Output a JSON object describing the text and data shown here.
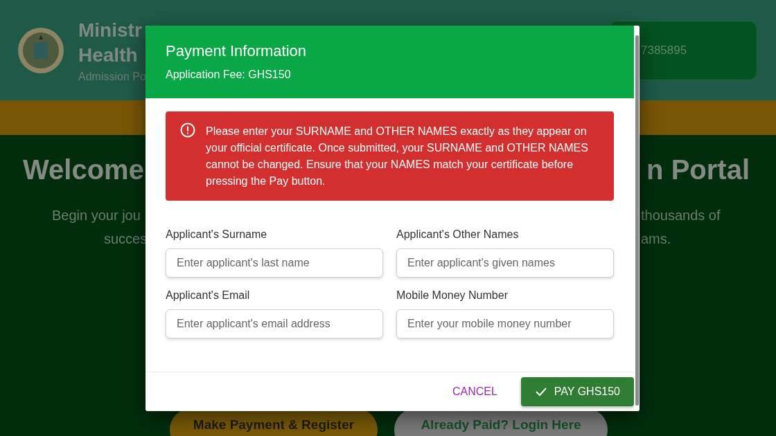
{
  "background": {
    "header": {
      "title_lines": [
        "Ministr",
        "Health"
      ],
      "subtitle": "Admission Po",
      "contact": "7385895"
    },
    "hero": {
      "heading_left": "Welcome",
      "heading_right": "n Portal",
      "text_left": [
        "Begin your jou",
        "succes"
      ],
      "text_right": [
        "thousands of",
        "ams."
      ]
    },
    "buttons": [
      {
        "label": "Make Payment & Register",
        "kind": "primary"
      },
      {
        "label": "Already Paid? Login Here",
        "kind": "secondary"
      }
    ]
  },
  "dialog": {
    "title": "Payment Information",
    "subtitle": "Application Fee: GHS150",
    "alert": "Please enter your SURNAME and OTHER NAMES exactly as they appear on your official certificate. Once submitted, your SURNAME and OTHER NAMES cannot be changed. Ensure that your NAMES match your certificate before pressing the Pay button.",
    "fields": [
      {
        "label": "Applicant's Surname",
        "placeholder": "Enter applicant's last name"
      },
      {
        "label": "Applicant's Other Names",
        "placeholder": "Enter applicant's given names"
      },
      {
        "label": "Applicant's Email",
        "placeholder": "Enter applicant's email address"
      },
      {
        "label": "Mobile Money Number",
        "placeholder": "Enter your mobile money number"
      }
    ],
    "buttons": [
      {
        "label": "CANCEL",
        "kind": "text"
      },
      {
        "label": "PAY GHS150",
        "kind": "contained"
      }
    ]
  }
}
